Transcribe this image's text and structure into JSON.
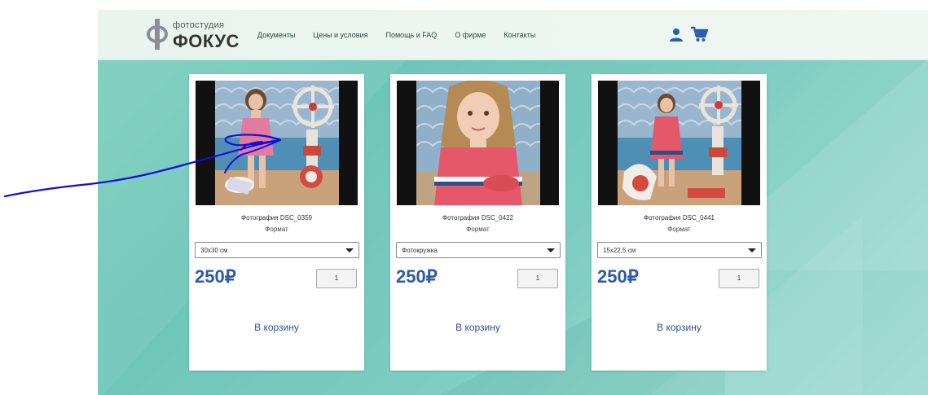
{
  "brand": {
    "top": "фотостудия",
    "name": "ФОКУС"
  },
  "nav": [
    {
      "label": "Документы"
    },
    {
      "label": "Цены и условия"
    },
    {
      "label": "Помощь и FAQ"
    },
    {
      "label": "О фирме"
    },
    {
      "label": "Контакты"
    }
  ],
  "icons": {
    "user": "user-icon",
    "cart": "cart-icon"
  },
  "colors": {
    "accent": "#2e5aa8",
    "price": "#2e5aa8",
    "teal_bg": "#7fd0c0",
    "annotation": "#1010d8"
  },
  "products": [
    {
      "caption": "Фотография DSC_0359",
      "format_label": "Формат",
      "selected_format": "30х30 см",
      "price": "250₽",
      "quantity": "1",
      "cart_label": "В корзину"
    },
    {
      "caption": "Фотография DSC_0422",
      "format_label": "Формат",
      "selected_format": "Фотокружка",
      "price": "250₽",
      "quantity": "1",
      "cart_label": "В корзину"
    },
    {
      "caption": "Фотография DSC_0441",
      "format_label": "Формат",
      "selected_format": "15х22,5 см",
      "price": "250₽",
      "quantity": "1",
      "cart_label": "В корзину"
    }
  ]
}
